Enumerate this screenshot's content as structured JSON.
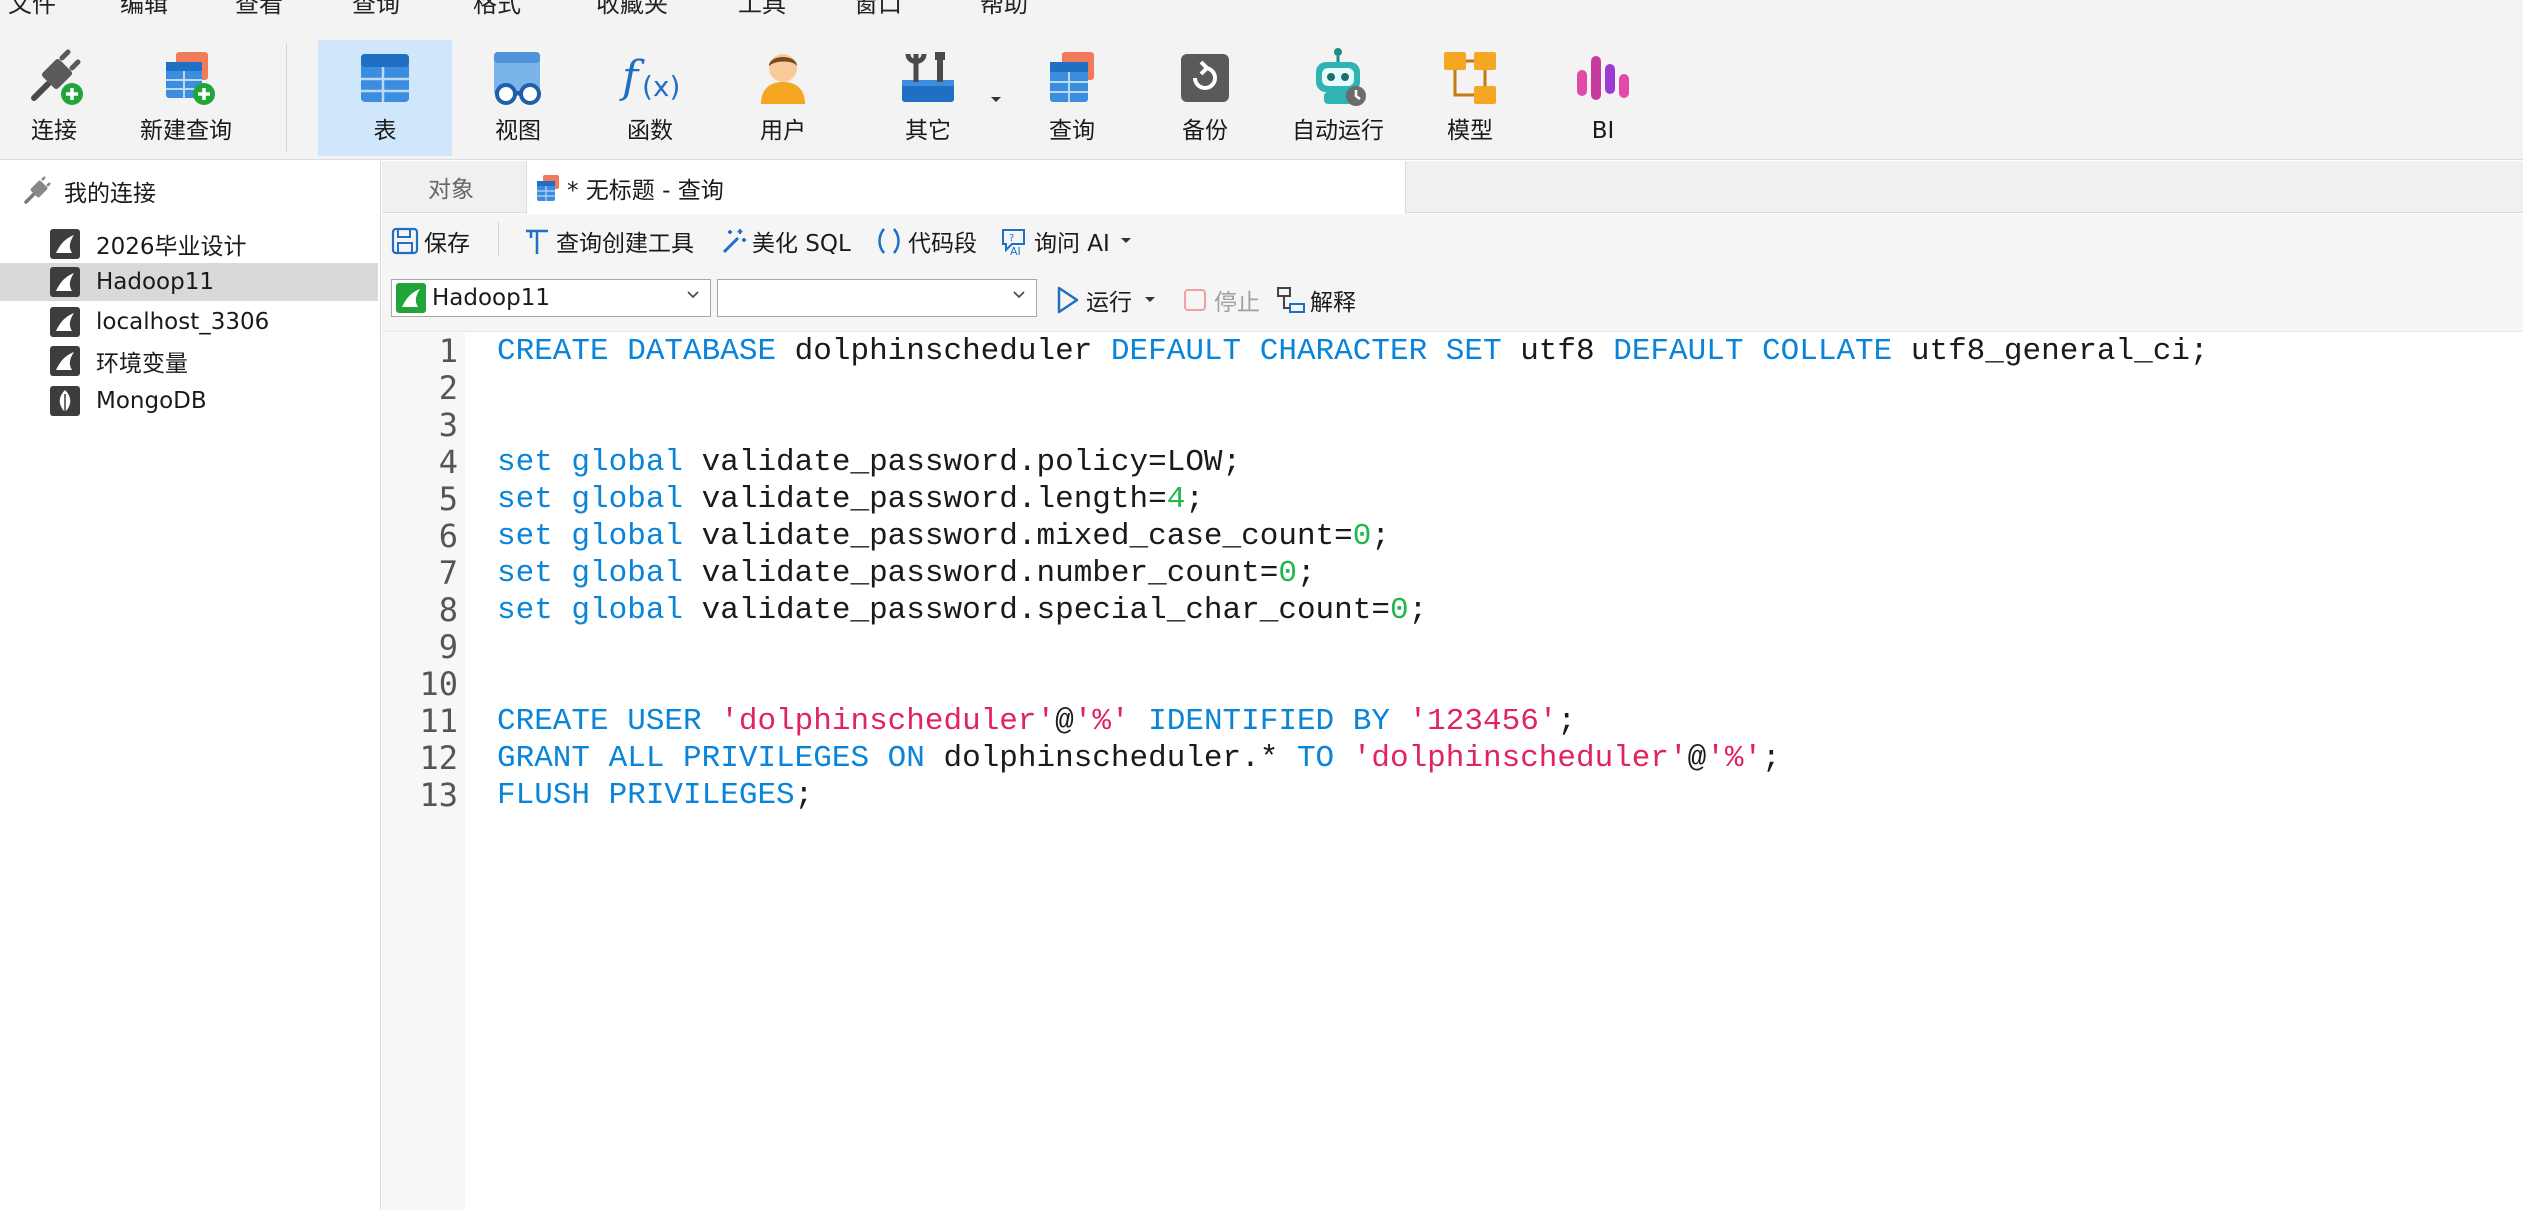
{
  "menu": [
    "文件",
    "编辑",
    "查看",
    "查询",
    "格式",
    "收藏夹",
    "工具",
    "窗口",
    "帮助"
  ],
  "ribbon": {
    "connect": "连接",
    "new_query": "新建查询",
    "table": "表",
    "view": "视图",
    "function": "函数",
    "user": "用户",
    "other": "其它",
    "query": "查询",
    "backup": "备份",
    "automation": "自动运行",
    "model": "模型",
    "bi": "BI"
  },
  "sidebar": {
    "root_label": "我的连接",
    "connections": [
      {
        "label": "2026毕业设计",
        "type": "mysql",
        "selected": false
      },
      {
        "label": "Hadoop11",
        "type": "mysql",
        "selected": true
      },
      {
        "label": "localhost_3306",
        "type": "mysql",
        "selected": false
      },
      {
        "label": "环境变量",
        "type": "mysql",
        "selected": false
      },
      {
        "label": "MongoDB",
        "type": "mongodb",
        "selected": false
      }
    ]
  },
  "tabs": {
    "objects": "对象",
    "query_tab": "* 无标题 - 查询"
  },
  "query_toolbar": {
    "save": "保存",
    "query_builder": "查询创建工具",
    "beautify": "美化 SQL",
    "snippets": "代码段",
    "ask_ai": "询问 AI",
    "connection_value": "Hadoop11",
    "database_value": "",
    "run": "运行",
    "stop": "停止",
    "explain": "解释"
  },
  "editor": {
    "line_numbers": [
      "1",
      "2",
      "3",
      "4",
      "5",
      "6",
      "7",
      "8",
      "9",
      "10",
      "11",
      "12",
      "13"
    ],
    "lines": [
      [
        {
          "t": "kw",
          "v": "CREATE DATABASE "
        },
        {
          "t": "id",
          "v": "dolphinscheduler "
        },
        {
          "t": "kw",
          "v": "DEFAULT CHARACTER SET "
        },
        {
          "t": "id",
          "v": "utf8 "
        },
        {
          "t": "kw",
          "v": "DEFAULT COLLATE "
        },
        {
          "t": "id",
          "v": "utf8_general_ci;"
        }
      ],
      [],
      [],
      [
        {
          "t": "kw",
          "v": "set global "
        },
        {
          "t": "id",
          "v": "validate_password.policy=LOW;"
        }
      ],
      [
        {
          "t": "kw",
          "v": "set global "
        },
        {
          "t": "id",
          "v": "validate_password.length="
        },
        {
          "t": "num",
          "v": "4"
        },
        {
          "t": "id",
          "v": ";"
        }
      ],
      [
        {
          "t": "kw",
          "v": "set global "
        },
        {
          "t": "id",
          "v": "validate_password.mixed_case_count="
        },
        {
          "t": "num",
          "v": "0"
        },
        {
          "t": "id",
          "v": ";"
        }
      ],
      [
        {
          "t": "kw",
          "v": "set global "
        },
        {
          "t": "id",
          "v": "validate_password.number_count="
        },
        {
          "t": "num",
          "v": "0"
        },
        {
          "t": "id",
          "v": ";"
        }
      ],
      [
        {
          "t": "kw",
          "v": "set global "
        },
        {
          "t": "id",
          "v": "validate_password.special_char_count="
        },
        {
          "t": "num",
          "v": "0"
        },
        {
          "t": "id",
          "v": ";"
        }
      ],
      [],
      [],
      [
        {
          "t": "kw",
          "v": "CREATE USER "
        },
        {
          "t": "str",
          "v": "'dolphinscheduler'"
        },
        {
          "t": "id",
          "v": "@"
        },
        {
          "t": "str",
          "v": "'%'"
        },
        {
          "t": "kw",
          "v": " IDENTIFIED BY "
        },
        {
          "t": "str",
          "v": "'123456'"
        },
        {
          "t": "id",
          "v": ";"
        }
      ],
      [
        {
          "t": "kw",
          "v": "GRANT ALL PRIVILEGES ON "
        },
        {
          "t": "id",
          "v": "dolphinscheduler.* "
        },
        {
          "t": "kw",
          "v": "TO "
        },
        {
          "t": "str",
          "v": "'dolphinscheduler'"
        },
        {
          "t": "id",
          "v": "@"
        },
        {
          "t": "str",
          "v": "'%'"
        },
        {
          "t": "id",
          "v": ";"
        }
      ],
      [
        {
          "t": "kw",
          "v": "FLUSH PRIVILEGES"
        },
        {
          "t": "id",
          "v": ";"
        }
      ]
    ]
  },
  "colors": {
    "keyword": "#0a84d9",
    "string": "#e0245e",
    "number": "#1fb84a",
    "ribbon_active": "#cfe6fb",
    "selection": "#d9d9d9"
  }
}
